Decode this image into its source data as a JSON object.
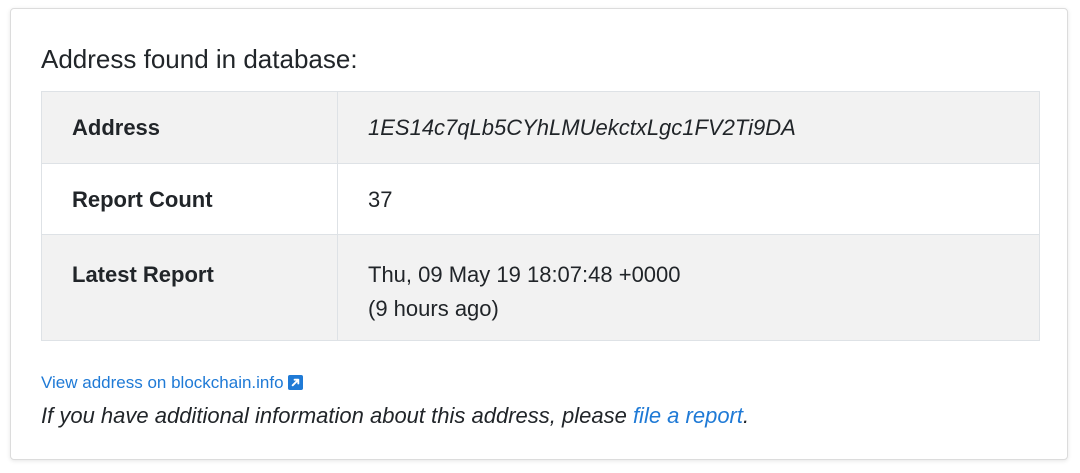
{
  "heading": "Address found in database:",
  "table": {
    "rows": [
      {
        "key": "Address",
        "value": "1ES14c7qLb5CYhLMUekctxLgc1FV2Ti9DA"
      },
      {
        "key": "Report Count",
        "value": "37"
      },
      {
        "key": "Latest Report",
        "value": "Thu, 09 May 19 18:07:48 +0000",
        "value2": "(9 hours ago)"
      }
    ]
  },
  "links": {
    "blockchain_label": "View address on blockchain.info",
    "external_icon": "external-link-icon"
  },
  "note": {
    "prefix": "If you have additional information about this address, please ",
    "link_text": "file a report",
    "suffix": "."
  },
  "colors": {
    "link": "#1f7ad6",
    "row_shade": "#f2f2f2",
    "border": "#dee2e6"
  }
}
